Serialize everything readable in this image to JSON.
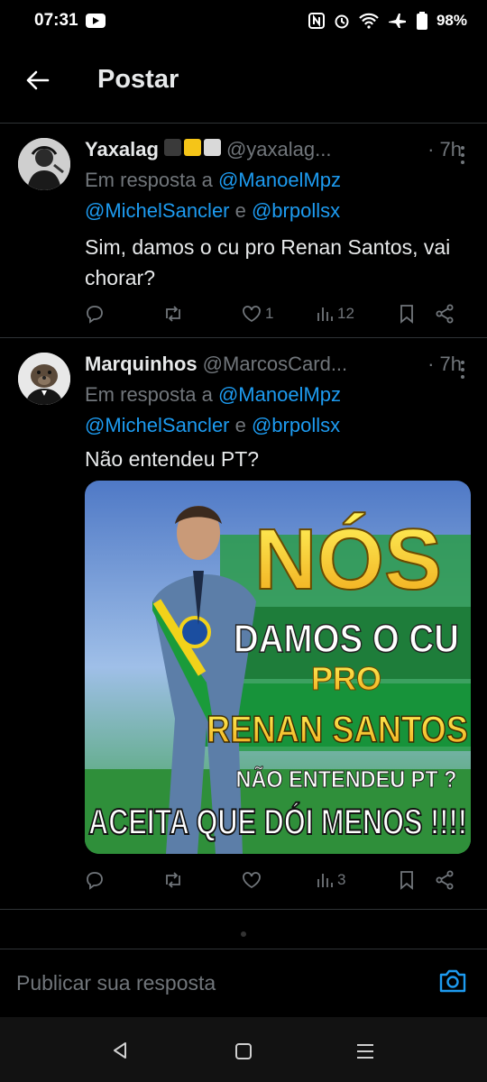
{
  "status_bar": {
    "time": "07:31",
    "battery": "98%"
  },
  "header": {
    "title": "Postar"
  },
  "tweets": [
    {
      "name": "Yaxalag",
      "handle": "@yaxalag...",
      "time": "· 7h",
      "reply_prefix": "Em resposta a ",
      "mention1": "@ManoelMpz",
      "mention2": "@MichelSancler",
      "conj": " e ",
      "mention3": "@brpollsx",
      "text": "Sim, damos o cu pro Renan Santos, vai chorar?",
      "likes": "1",
      "views": "12"
    },
    {
      "name": "Marquinhos",
      "handle": "@MarcosCard...",
      "time": "· 7h",
      "reply_prefix": "Em resposta a ",
      "mention1": "@ManoelMpz",
      "mention2": "@MichelSancler",
      "conj": " e ",
      "mention3": "@brpollsx",
      "text": "Não entendeu PT?",
      "likes": "",
      "views": "3",
      "image_text": {
        "line1": "NÓS",
        "line2": "DAMOS O CU",
        "line3": "PRO",
        "line4": "RENAN SANTOS",
        "line5": "NÃO ENTENDEU  PT ?",
        "line6": "ACEITA  QUE DÓI MENOS !!!!"
      }
    }
  ],
  "composer": {
    "placeholder": "Publicar sua resposta"
  },
  "colors": {
    "accent": "#1d9bf0",
    "muted": "#71767b",
    "text": "#e7e9ea",
    "background": "#000000"
  }
}
